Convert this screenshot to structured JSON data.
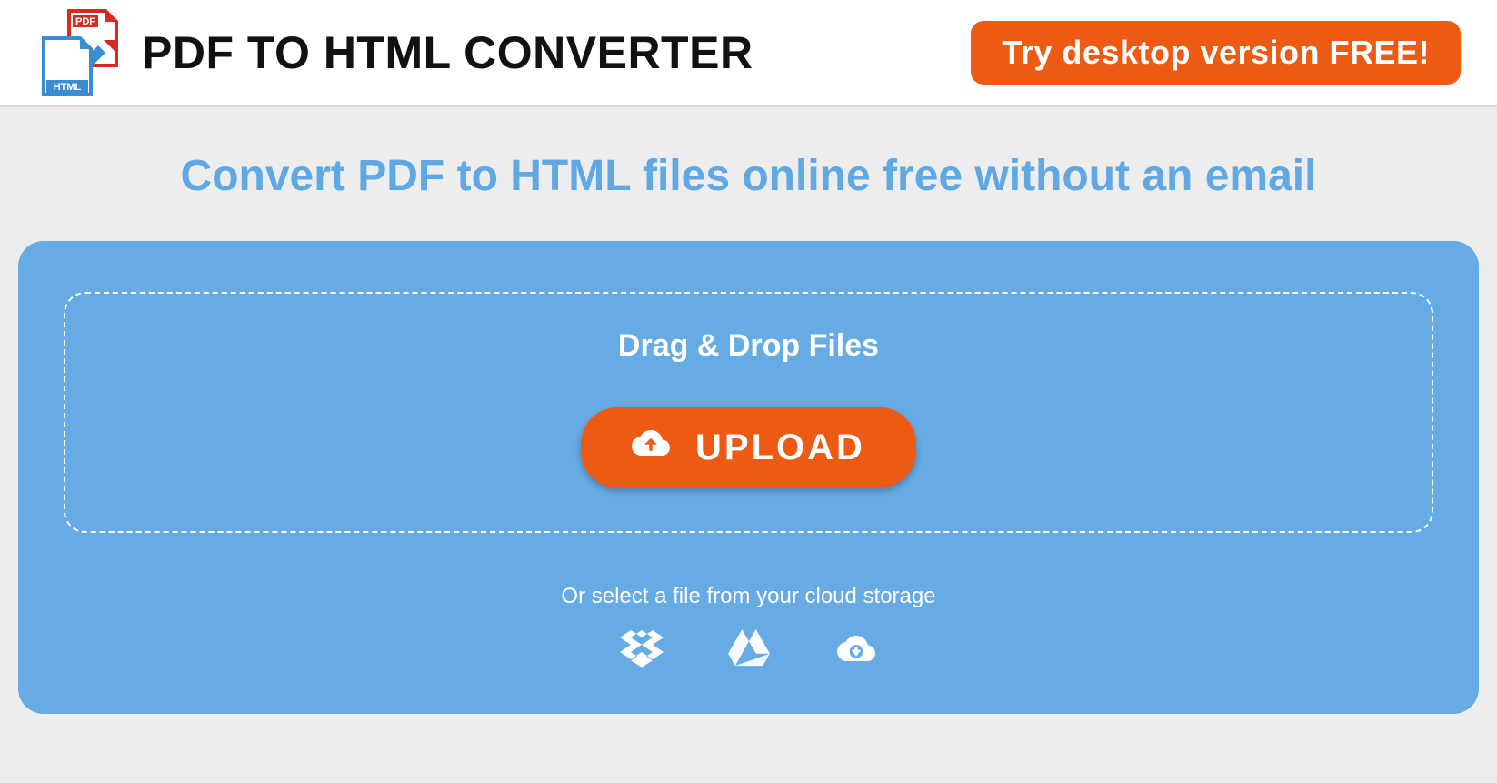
{
  "header": {
    "title": "PDF TO HTML CONVERTER",
    "cta_label": "Try desktop version FREE!",
    "logo": {
      "pdf_label": "PDF",
      "html_label": "HTML"
    }
  },
  "main": {
    "subtitle": "Convert PDF to HTML files online free without an email",
    "dropzone": {
      "drag_text": "Drag & Drop Files",
      "upload_label": "UPLOAD",
      "cloud_text": "Or select a file from your cloud storage",
      "providers": [
        "dropbox",
        "google-drive",
        "cloud-download"
      ]
    }
  },
  "colors": {
    "accent_orange": "#ec5a13",
    "panel_blue": "#67abe4",
    "subtitle_blue": "#5fa8e4"
  }
}
